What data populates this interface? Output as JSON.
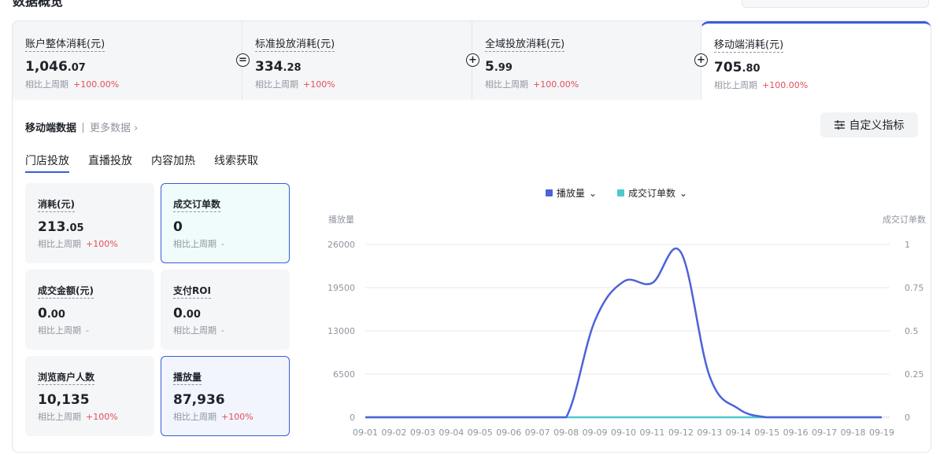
{
  "header": {
    "title": "数据概览"
  },
  "summary": [
    {
      "label": "账户整体消耗(元)",
      "int": "1,046",
      "dec": ".07",
      "cmp_label": "相比上周期",
      "cmp_value": "+100.00%"
    },
    {
      "label": "标准投放消耗(元)",
      "int": "334",
      "dec": ".28",
      "cmp_label": "相比上周期",
      "cmp_value": "+100%"
    },
    {
      "label": "全域投放消耗(元)",
      "int": "5",
      "dec": ".99",
      "cmp_label": "相比上周期",
      "cmp_value": "+100.00%"
    },
    {
      "label": "移动端消耗(元)",
      "int": "705",
      "dec": ".80",
      "cmp_label": "相比上周期",
      "cmp_value": "+100.00%"
    }
  ],
  "operators": [
    "=",
    "+",
    "+"
  ],
  "subhead": {
    "title": "移动端数据",
    "more": "更多数据",
    "more_icon": "chevron-right-icon"
  },
  "custom_button": {
    "label": "自定义指标",
    "icon": "sliders-icon"
  },
  "tabs": [
    "门店投放",
    "直播投放",
    "内容加热",
    "线索获取"
  ],
  "metrics": [
    {
      "label": "消耗(元)",
      "int": "213",
      "dec": ".05",
      "cmp_label": "相比上周期",
      "cmp_value": "+100%"
    },
    {
      "label": "成交订单数",
      "int": "0",
      "dec": "",
      "cmp_label": "相比上周期",
      "cmp_value": "-"
    },
    {
      "label": "成交金额(元)",
      "int": "0",
      "dec": ".00",
      "cmp_label": "相比上周期",
      "cmp_value": "-"
    },
    {
      "label": "支付ROI",
      "int": "0",
      "dec": ".00",
      "cmp_label": "相比上周期",
      "cmp_value": "-"
    },
    {
      "label": "浏览商户人数",
      "int": "10,135",
      "dec": "",
      "cmp_label": "相比上周期",
      "cmp_value": "+100%"
    },
    {
      "label": "播放量",
      "int": "87,936",
      "dec": "",
      "cmp_label": "相比上周期",
      "cmp_value": "+100%"
    }
  ],
  "colors": {
    "accent": "#3b5bdb",
    "series1": "#4c63d9",
    "series2": "#4cc8cf",
    "up": "#e34d59"
  },
  "chart_data": {
    "type": "line",
    "x": [
      "09-01",
      "09-02",
      "09-03",
      "09-04",
      "09-05",
      "09-06",
      "09-07",
      "09-08",
      "09-09",
      "09-10",
      "09-11",
      "09-12",
      "09-13",
      "09-14",
      "09-15",
      "09-16",
      "09-17",
      "09-18",
      "09-19"
    ],
    "series": [
      {
        "name": "播放量",
        "axis": "left",
        "values": [
          0,
          0,
          0,
          0,
          0,
          0,
          0,
          0,
          14500,
          20400,
          20200,
          24800,
          6200,
          1300,
          0,
          0,
          0,
          0,
          0
        ]
      },
      {
        "name": "成交订单数",
        "axis": "right",
        "values": [
          0,
          0,
          0,
          0,
          0,
          0,
          0,
          0,
          0,
          0,
          0,
          0,
          0,
          0,
          0,
          0,
          0,
          0,
          0
        ]
      }
    ],
    "ylabel": "播放量",
    "y2label": "成交订单数",
    "yticks": [
      "26000",
      "19500",
      "13000",
      "6500",
      "0"
    ],
    "y2ticks": [
      "1",
      "0.75",
      "0.5",
      "0.25",
      "0"
    ],
    "ylim": [
      0,
      26000
    ],
    "y2lim": [
      0,
      1
    ],
    "grid": true,
    "legend_position": "top-center"
  }
}
